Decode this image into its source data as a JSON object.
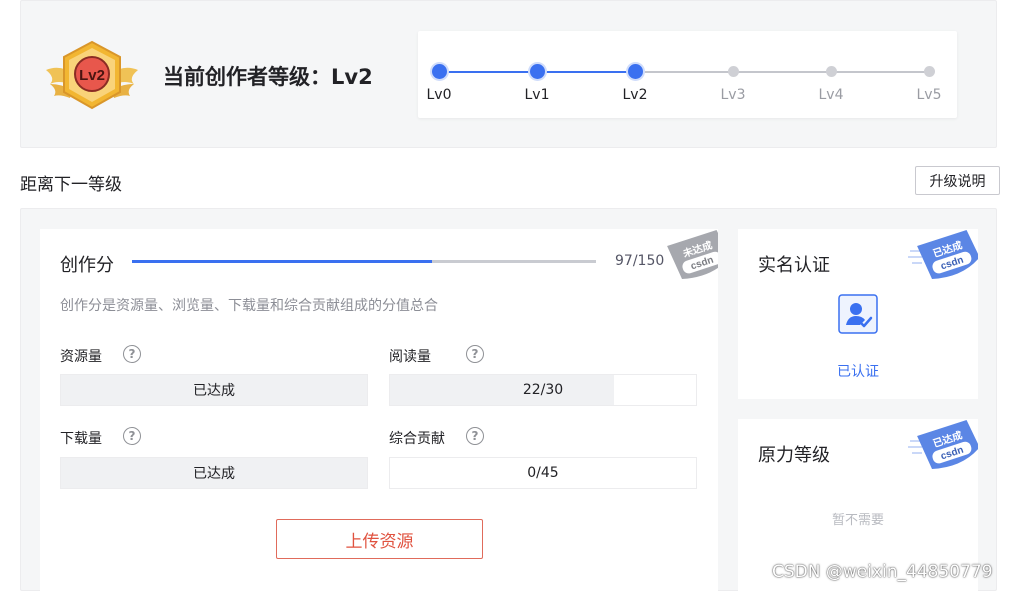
{
  "level": {
    "badge_text": "Lv2",
    "title": "当前创作者等级：Lv2",
    "steps": [
      {
        "label": "Lv0",
        "reached": true
      },
      {
        "label": "Lv1",
        "reached": true
      },
      {
        "label": "Lv2",
        "reached": true
      },
      {
        "label": "Lv3",
        "reached": false
      },
      {
        "label": "Lv4",
        "reached": false
      },
      {
        "label": "Lv5",
        "reached": false
      }
    ]
  },
  "next_level": {
    "heading": "距离下一等级",
    "upgrade_button": "升级说明"
  },
  "score": {
    "title": "创作分",
    "value_text": "97/150",
    "progress": 0.647,
    "description": "创作分是资源量、浏览量、下载量和综合贡献组成的分值总合",
    "stamp_text": "未达成",
    "stamp_brand": "csdn",
    "metrics": [
      {
        "label": "资源量",
        "help": "?",
        "value": "已达成",
        "progress": 1.0
      },
      {
        "label": "阅读量",
        "help": "?",
        "value": "22/30",
        "progress": 0.733
      },
      {
        "label": "下载量",
        "help": "?",
        "value": "已达成",
        "progress": 1.0
      },
      {
        "label": "综合贡献",
        "help": "?",
        "value": "0/45",
        "progress": 0.0
      }
    ],
    "upload_button": "上传资源"
  },
  "realname": {
    "title": "实名认证",
    "status": "已认证",
    "icon": "verified-user-icon",
    "stamp_text": "已达成",
    "stamp_brand": "csdn"
  },
  "force": {
    "title": "原力等级",
    "status": "暂不需要",
    "stamp_text": "已达成",
    "stamp_brand": "csdn"
  },
  "watermark": "CSDN @weixin_44850779",
  "colors": {
    "accent": "#3a70f0",
    "upload_red": "#e0523f",
    "badge_gold": "#f2b632",
    "badge_red": "#e8574c",
    "stamp_grey": "#9a9ca3",
    "stamp_blue": "#5b86e5"
  }
}
